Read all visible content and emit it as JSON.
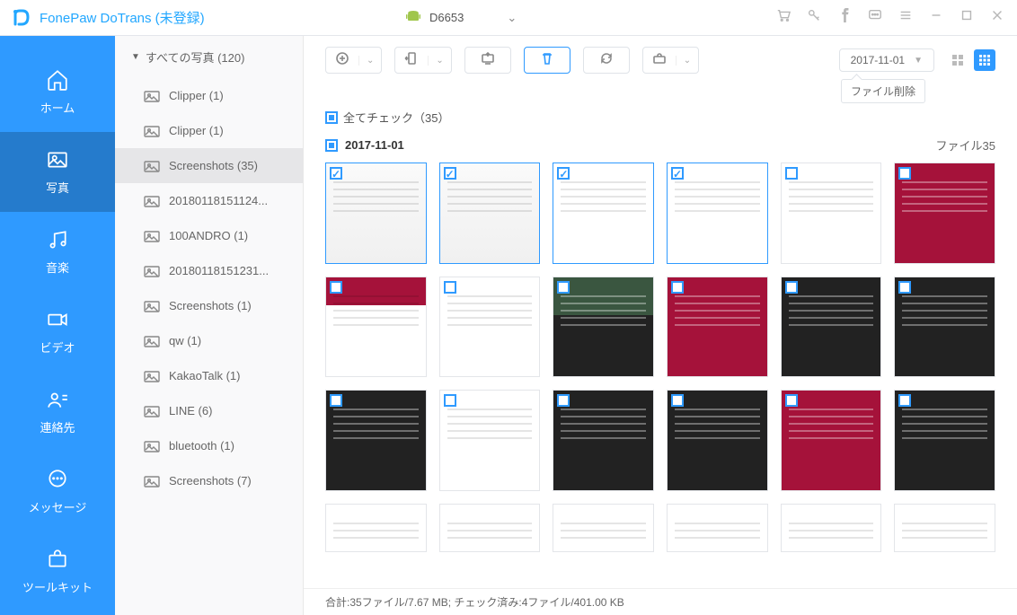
{
  "title": "FonePaw DoTrans (未登録)",
  "device": {
    "name": "D6653"
  },
  "nav": {
    "home": "ホーム",
    "photos": "写真",
    "music": "音楽",
    "video": "ビデオ",
    "contacts": "連絡先",
    "messages": "メッセージ",
    "tools": "ツールキット"
  },
  "sidebar": {
    "root": "すべての写真 (120)",
    "folders": [
      {
        "label": "Clipper (1)"
      },
      {
        "label": "Clipper (1)"
      },
      {
        "label": "Screenshots (35)",
        "active": true
      },
      {
        "label": "20180118151124..."
      },
      {
        "label": "100ANDRO (1)"
      },
      {
        "label": "20180118151231..."
      },
      {
        "label": "Screenshots (1)"
      },
      {
        "label": "qw (1)"
      },
      {
        "label": "KakaoTalk (1)"
      },
      {
        "label": "LINE (6)"
      },
      {
        "label": "bluetooth (1)"
      },
      {
        "label": "Screenshots (7)"
      }
    ]
  },
  "toolbar": {
    "tooltip": "ファイル削除",
    "date": "2017-11-01"
  },
  "checkall": "全てチェック（35）",
  "dateheader": {
    "date": "2017-11-01",
    "right": "ファイル35"
  },
  "thumbs": [
    {
      "style": "t-light",
      "checked": true,
      "sel": true
    },
    {
      "style": "t-light",
      "checked": true,
      "sel": true
    },
    {
      "style": "t-white",
      "checked": true,
      "sel": true
    },
    {
      "style": "t-white",
      "checked": true,
      "sel": true
    },
    {
      "style": "t-white",
      "checked": false
    },
    {
      "style": "t-pink-full",
      "checked": false
    },
    {
      "style": "t-pink-split",
      "checked": false
    },
    {
      "style": "t-white",
      "checked": false
    },
    {
      "style": "t-green",
      "checked": false
    },
    {
      "style": "t-pink-full",
      "checked": false
    },
    {
      "style": "t-dark",
      "checked": false
    },
    {
      "style": "t-dark",
      "checked": false
    },
    {
      "style": "t-dark",
      "checked": false
    },
    {
      "style": "t-white",
      "checked": false
    },
    {
      "style": "t-dark",
      "checked": false
    },
    {
      "style": "t-dark",
      "checked": false
    },
    {
      "style": "t-pink-full",
      "checked": false
    },
    {
      "style": "t-dark",
      "checked": false
    }
  ],
  "thumbs_row3": [
    {
      "style": "t-white"
    },
    {
      "style": "t-white"
    },
    {
      "style": "t-white"
    },
    {
      "style": "t-white"
    },
    {
      "style": "t-white"
    },
    {
      "style": "t-white"
    }
  ],
  "statusbar": "合計:35ファイル/7.67 MB; チェック済み:4ファイル/401.00 KB"
}
